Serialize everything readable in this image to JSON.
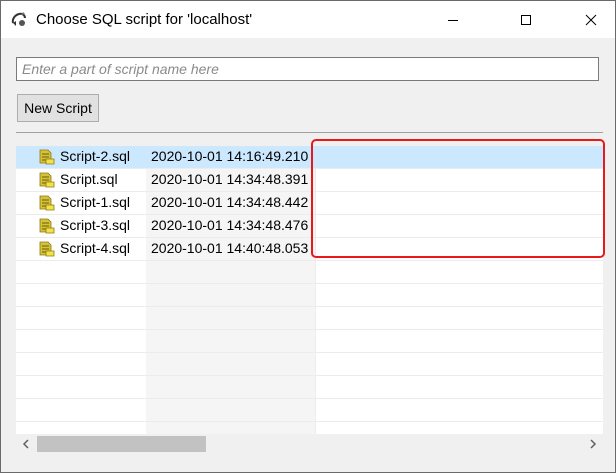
{
  "window": {
    "title": "Choose SQL script for 'localhost'",
    "icon": "database-plug-icon"
  },
  "controls": {
    "minimize": "minimize-icon",
    "maximize": "maximize-icon",
    "close": "close-icon"
  },
  "search": {
    "placeholder": "Enter a part of script name here",
    "value": ""
  },
  "toolbar": {
    "new_script_label": "New Script"
  },
  "scripts": [
    {
      "name": "Script-2.sql",
      "modified": "2020-10-01 14:16:49.210",
      "description": "",
      "selected": true
    },
    {
      "name": "Script.sql",
      "modified": "2020-10-01 14:34:48.391",
      "description": "",
      "selected": false
    },
    {
      "name": "Script-1.sql",
      "modified": "2020-10-01 14:34:48.442",
      "description": "",
      "selected": false
    },
    {
      "name": "Script-3.sql",
      "modified": "2020-10-01 14:34:48.476",
      "description": "",
      "selected": false
    },
    {
      "name": "Script-4.sql",
      "modified": "2020-10-01 14:40:48.053",
      "description": "",
      "selected": false
    }
  ],
  "script_icon": "sql-script-icon",
  "colors": {
    "selection": "#cce8ff",
    "highlight_border": "#e8191b"
  }
}
